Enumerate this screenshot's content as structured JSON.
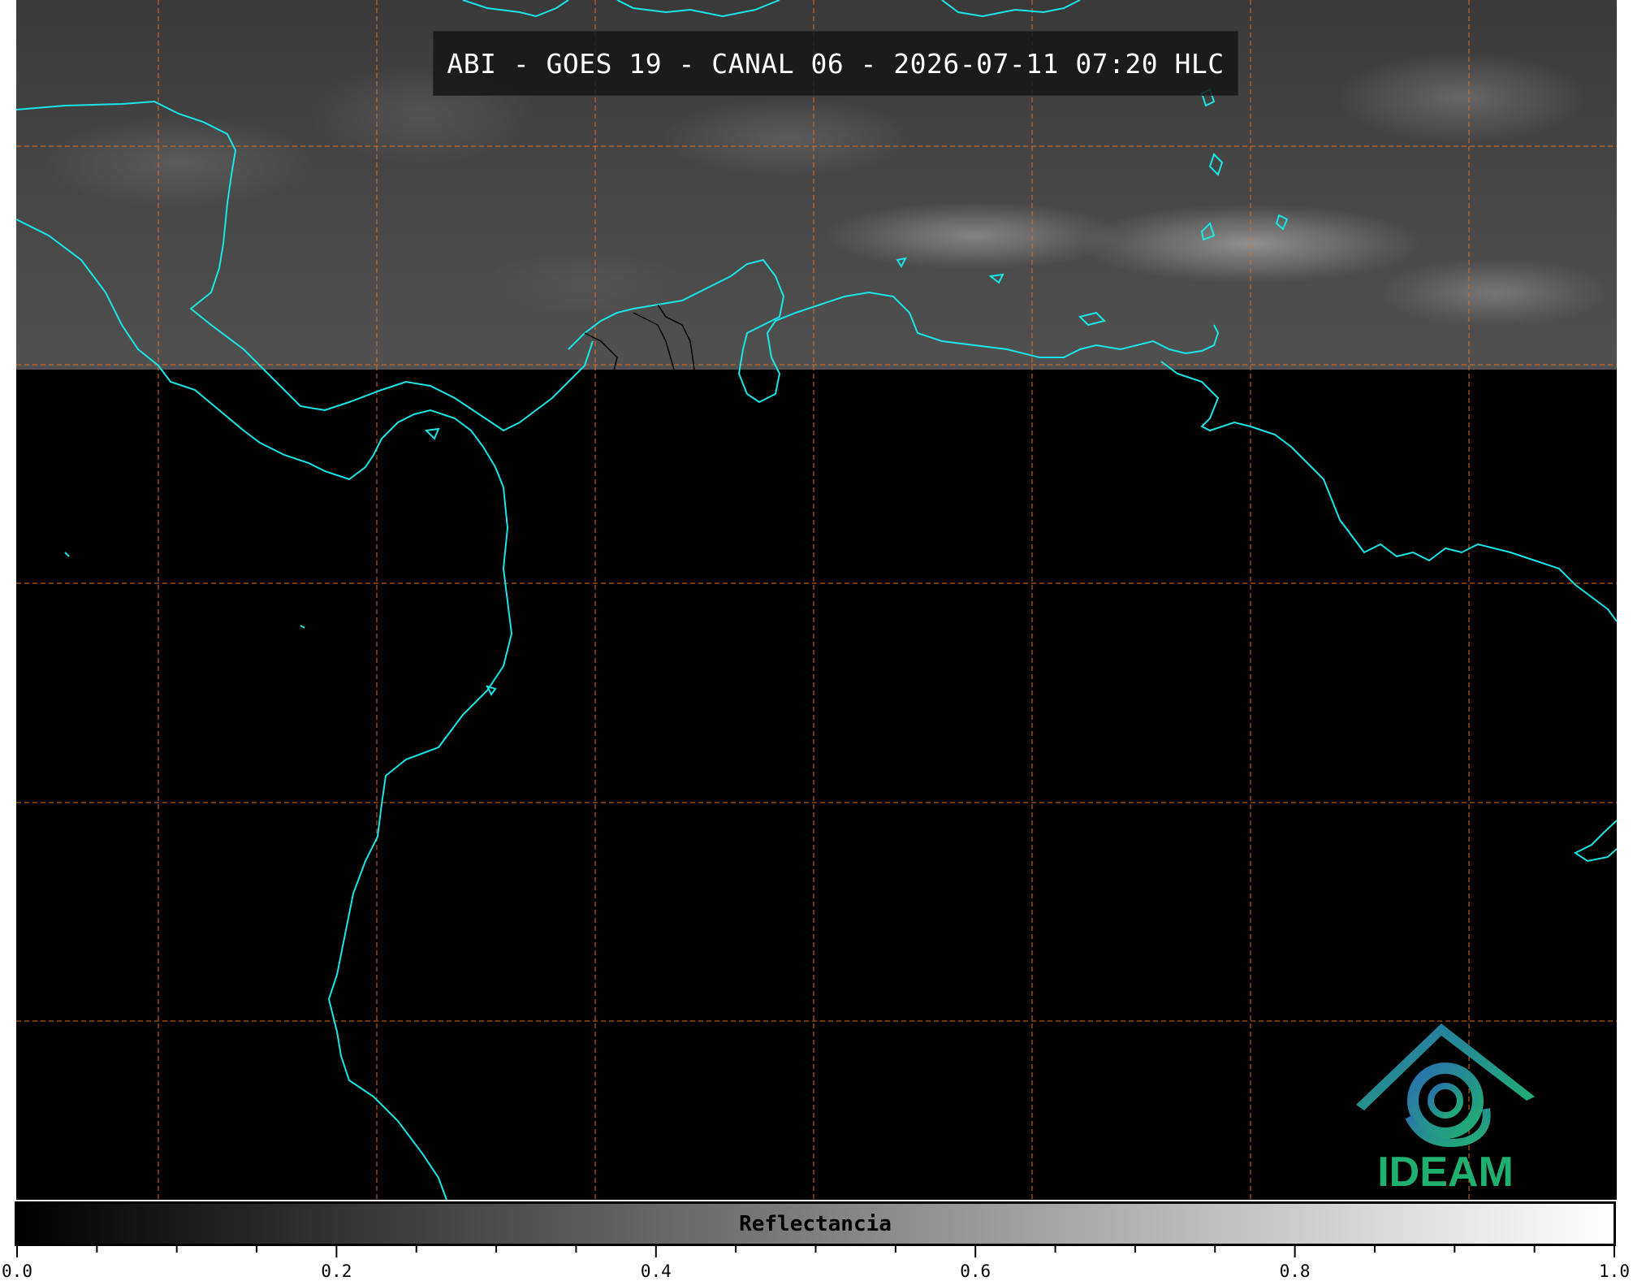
{
  "title": "ABI - GOES 19 - CANAL 06 - 2026-07-11 07:20 HLC",
  "logo": {
    "text": "IDEAM"
  },
  "colorbar": {
    "label": "Reflectancia",
    "min": 0.0,
    "max": 1.0,
    "tick_labels": [
      "0.0",
      "0.2",
      "0.4",
      "0.6",
      "0.8",
      "1.0"
    ],
    "colors": {
      "start": "#000000",
      "end": "#ffffff"
    }
  },
  "map": {
    "coastline_color": "#19e6e6",
    "graticule_color": "#e07020",
    "imagery_extent_fraction": 0.3,
    "no_data_color": "#000000"
  }
}
